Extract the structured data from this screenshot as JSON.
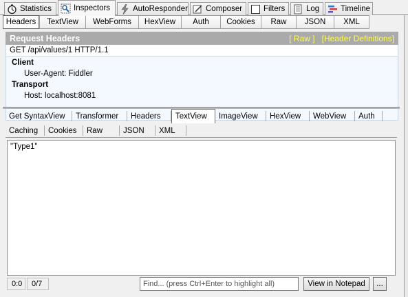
{
  "main_tabs": [
    {
      "label": "Statistics",
      "icon": "stopwatch-icon"
    },
    {
      "label": "Inspectors",
      "icon": "inspector-icon"
    },
    {
      "label": "AutoResponder",
      "icon": "lightning-icon"
    },
    {
      "label": "Composer",
      "icon": "composer-icon"
    },
    {
      "label": "Filters",
      "icon": "checkbox-icon"
    },
    {
      "label": "Log",
      "icon": "log-icon"
    },
    {
      "label": "Timeline",
      "icon": "timeline-icon"
    }
  ],
  "request": {
    "tabs": [
      "Headers",
      "TextView",
      "WebForms",
      "HexView",
      "Auth",
      "Cookies",
      "Raw",
      "JSON",
      "XML"
    ],
    "active_tab": "Headers",
    "section_title": "Request Headers",
    "links": [
      "[ Raw ]",
      "[Header Definitions]"
    ],
    "request_line": "GET /api/values/1 HTTP/1.1",
    "groups": [
      {
        "title": "Client",
        "items": [
          "User-Agent: Fiddler"
        ]
      },
      {
        "title": "Transport",
        "items": [
          "Host: localhost:8081"
        ]
      }
    ]
  },
  "response": {
    "tabs_row1": [
      "Get SyntaxView",
      "Transformer",
      "Headers",
      "TextView",
      "ImageView",
      "HexView",
      "WebView",
      "Auth"
    ],
    "tabs_row2": [
      "Caching",
      "Cookies",
      "Raw",
      "JSON",
      "XML"
    ],
    "active_tab": "TextView",
    "body_text": "\"Type1\"",
    "status": {
      "position": "0:0",
      "count": "0/7",
      "find_placeholder": "Find... (press Ctrl+Enter to highlight all)",
      "notepad_button": "View in Notepad",
      "more_button": "..."
    }
  },
  "colors": {
    "header_bar": "#aaaaaa",
    "link_yellow": "#ffff4a",
    "panel_bg": "#f4f9ff"
  }
}
